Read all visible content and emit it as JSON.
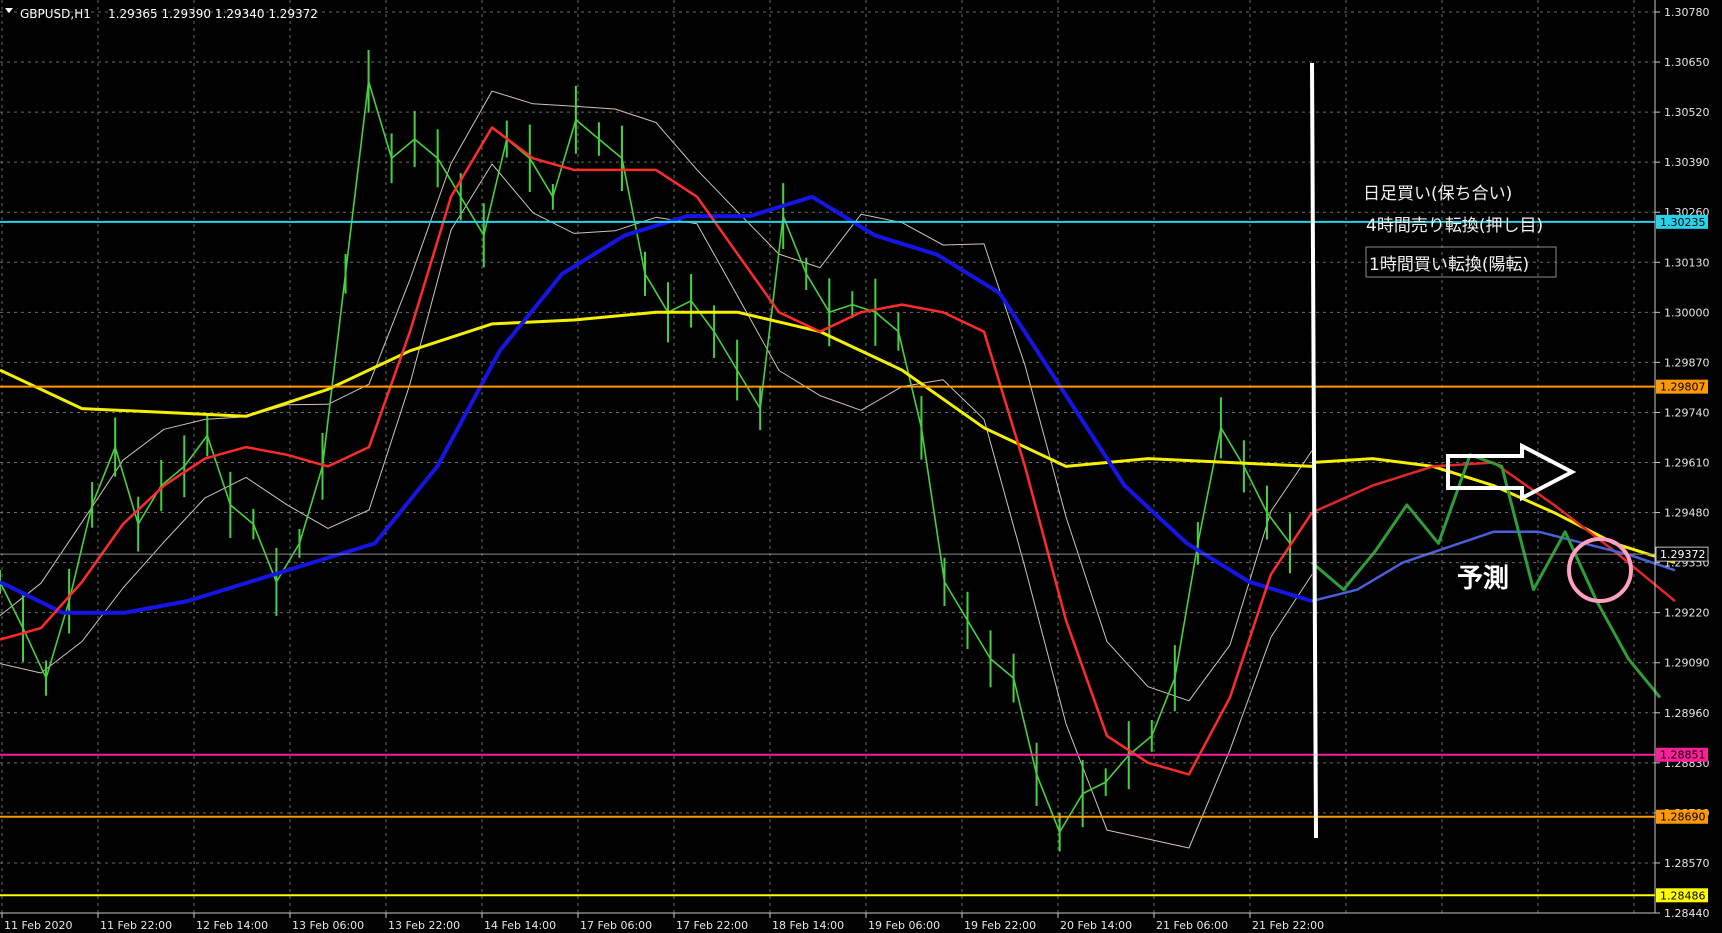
{
  "header": {
    "symbol_text": "GBPUSD,H1",
    "ohlc_text": "1.29365 1.29390 1.29340 1.29372"
  },
  "chart_data": {
    "type": "line",
    "ylim": [
      1.2844,
      1.3078
    ],
    "grid": true,
    "price_ticks": [
      "1.30780",
      "1.30650",
      "1.30520",
      "1.30390",
      "1.30260",
      "1.30130",
      "1.30000",
      "1.29870",
      "1.29740",
      "1.29610",
      "1.29480",
      "1.29350",
      "1.29220",
      "1.29090",
      "1.28960",
      "1.28830",
      "1.28700",
      "1.28570",
      "1.28440"
    ],
    "time_labels": [
      "11 Feb 2020",
      "11 Feb 22:00",
      "12 Feb 14:00",
      "13 Feb 06:00",
      "13 Feb 22:00",
      "14 Feb 14:00",
      "17 Feb 06:00",
      "17 Feb 22:00",
      "18 Feb 14:00",
      "19 Feb 06:00",
      "19 Feb 22:00",
      "20 Feb 14:00",
      "21 Feb 06:00",
      "21 Feb 22:00"
    ],
    "hlines": [
      {
        "price": 1.30235,
        "label": "1.30235",
        "color": "#27d3e8"
      },
      {
        "price": 1.29807,
        "label": "1.29807",
        "color": "#ff9900"
      },
      {
        "price": 1.28851,
        "label": "1.28851",
        "color": "#ff1f9a"
      },
      {
        "price": 1.2869,
        "label": "1.28690",
        "color": "#ff9900"
      },
      {
        "price": 1.28486,
        "label": "1.28486",
        "color": "#ffff00"
      }
    ],
    "current_price": {
      "price": 1.29372,
      "label": "1.29372",
      "color": "#c0c0c0"
    },
    "series": [
      {
        "color": "#46d13e",
        "values": [
          1.293,
          1.2918,
          1.2905,
          1.2925,
          1.295,
          1.2965,
          1.2945,
          1.2955,
          1.296,
          1.2968,
          1.295,
          1.2945,
          1.293,
          1.294,
          1.296,
          1.301,
          1.306,
          1.304,
          1.3045,
          1.304,
          1.303,
          1.302,
          1.3045,
          1.304,
          1.303,
          1.305,
          1.3045,
          1.304,
          1.301,
          1.3,
          1.3003,
          1.2995,
          1.2985,
          1.2975,
          1.3025,
          1.301,
          1.3,
          1.3002,
          1.3,
          1.2995,
          1.297,
          1.293,
          1.292,
          1.291,
          1.2905,
          1.288,
          1.2865,
          1.2875,
          1.2878,
          1.2885,
          1.289,
          1.2905,
          1.294,
          1.297,
          1.296,
          1.2948,
          1.294
        ]
      },
      {
        "color": "#ff2b2b",
        "values": [
          1.2915,
          1.2918,
          1.293,
          1.2945,
          1.2955,
          1.2962,
          1.2965,
          1.2963,
          1.296,
          1.2965,
          1.2995,
          1.303,
          1.3048,
          1.304,
          1.3037,
          1.3037,
          1.3037,
          1.303,
          1.3015,
          1.3,
          1.2995,
          1.3,
          1.3002,
          1.3,
          1.2995,
          1.296,
          1.292,
          1.289,
          1.2883,
          1.288,
          1.29,
          1.2932,
          1.2948
        ]
      },
      {
        "color": "#1515e6",
        "values": [
          1.293,
          1.2922,
          1.2922,
          1.2925,
          1.293,
          1.2935,
          1.294,
          1.296,
          1.299,
          1.301,
          1.302,
          1.3025,
          1.3025,
          1.303,
          1.302,
          1.3015,
          1.3005,
          1.298,
          1.2955,
          1.294,
          1.293,
          1.2925
        ]
      },
      {
        "color": "#f4f000",
        "values": [
          1.2985,
          1.2975,
          1.2974,
          1.2973,
          1.298,
          1.299,
          1.2997,
          1.2998,
          1.3,
          1.3,
          1.2995,
          1.2985,
          1.297,
          1.296,
          1.2962,
          1.2961,
          1.296
        ]
      },
      {
        "color": "#4a5fd8",
        "values": [
          1.2925,
          1.2928,
          1.2935,
          1.2939,
          1.2943,
          1.2943,
          1.294,
          1.2937,
          1.2933
        ]
      },
      {
        "color": "#2e9e3a",
        "values": [
          1.2935,
          1.2928,
          1.2938,
          1.295,
          1.294,
          1.2963,
          1.296,
          1.2928,
          1.2943,
          1.2925,
          1.291,
          1.29
        ]
      }
    ]
  },
  "annotations": {
    "line1": "日足買い(保ち合い)",
    "line2": "4時間売り転換(押し目)",
    "line3": "1時間買い転換(陽転)",
    "forecast": "予測"
  }
}
